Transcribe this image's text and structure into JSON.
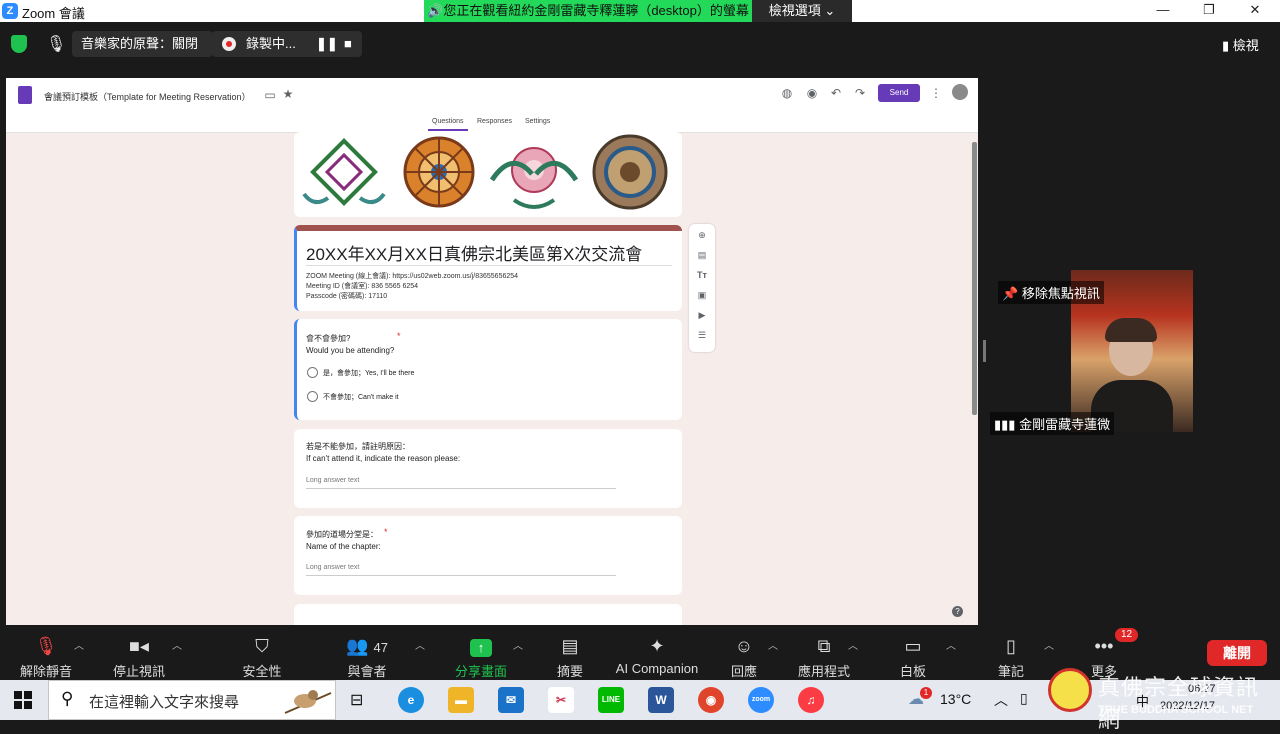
{
  "window": {
    "title": "Zoom 會議",
    "logo_letter": "Z"
  },
  "share_banner": {
    "text": "🔊您正在觀看紐約金剛雷藏寺釋蓮聹（desktop）的螢幕",
    "view_options": "檢視選項 ⌄"
  },
  "top_bar": {
    "audio_original": "音樂家的原聲：關閉",
    "recording": "錄製中...",
    "view_label": "檢視"
  },
  "form": {
    "doc_title": "會議預訂模板（Template for Meeting Reservation）",
    "send": "Send",
    "tabs": [
      "Questions",
      "Responses",
      "Settings"
    ],
    "heading": "20XX年XX月XX日真佛宗北美區第X次交流會",
    "desc_lines": [
      "ZOOM Meeting (線上會議): https://us02web.zoom.us/j/83655656254",
      "Meeting ID (會議室): 836 5565 6254",
      "Passcode (密碼碼): 17110"
    ],
    "q1": {
      "title": "會不會參加?",
      "subtitle": "Would you be attending?",
      "options": [
        "是，會參加；Yes, I'll be there",
        "不會參加；Can't make it"
      ]
    },
    "q2": {
      "title": "若是不能參加，請註明原因：",
      "subtitle": "If can't attend it, indicate the reason please:",
      "placeholder": "Long answer text"
    },
    "q3": {
      "title": "參加的道場分堂是：",
      "subtitle": "Name of the chapter:",
      "placeholder": "Long answer text"
    },
    "required_mark": "*"
  },
  "video": {
    "remove_spotlight": "移除焦點視訊",
    "participant_name": "金剛雷藏寺蓮微"
  },
  "toolbar": {
    "items": [
      {
        "icon": "mic-off-icon",
        "label": "解除靜音"
      },
      {
        "icon": "video-icon",
        "label": "停止視訊"
      },
      {
        "icon": "shield-icon",
        "label": "安全性"
      },
      {
        "icon": "participants-icon",
        "label": "與會者",
        "count": "47"
      },
      {
        "icon": "share-icon",
        "label": "分享畫面"
      },
      {
        "icon": "summary-icon",
        "label": "摘要"
      },
      {
        "icon": "ai-companion-icon",
        "label": "AI Companion"
      },
      {
        "icon": "reaction-icon",
        "label": "回應"
      },
      {
        "icon": "apps-icon",
        "label": "應用程式"
      },
      {
        "icon": "whiteboard-icon",
        "label": "白板"
      },
      {
        "icon": "notes-icon",
        "label": "筆記"
      },
      {
        "icon": "more-icon",
        "label": "更多"
      }
    ],
    "more_badge": "12",
    "leave": "離開"
  },
  "taskbar": {
    "search_placeholder": "在這裡輸入文字來搜尋",
    "weather": "13°C",
    "weather_badge": "1",
    "time": "06:27",
    "date": "2022/12/17",
    "ime": "中"
  },
  "watermark": {
    "text": "真佛宗全球資訊網",
    "sub": "TRUE BUDDHA SCHOOL NET"
  },
  "colors": {
    "zoom_blue": "#2d8cff",
    "banner_green": "#23d959",
    "form_purple": "#673ab7",
    "leave_red": "#e02828",
    "share_green": "#1fc24f"
  }
}
